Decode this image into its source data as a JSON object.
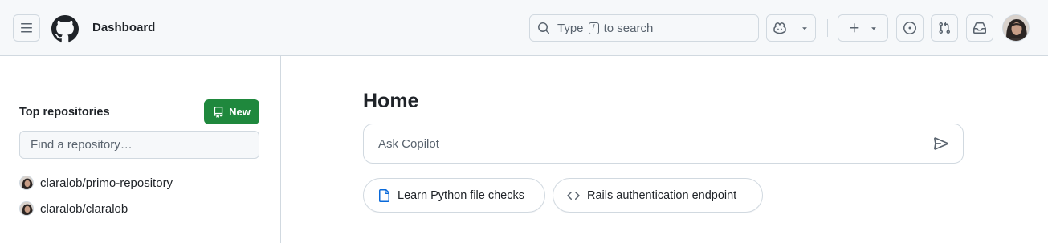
{
  "header": {
    "title": "Dashboard",
    "search": {
      "prefix": "Type",
      "key": "/",
      "suffix": "to search"
    },
    "icons": [
      "hamburger-menu-icon",
      "github-logo",
      "search-icon",
      "copilot-icon",
      "chevron-down-icon",
      "plus-icon",
      "issue-opened-icon",
      "git-pull-request-icon",
      "inbox-icon"
    ]
  },
  "sidebar": {
    "title": "Top repositories",
    "new_label": "New",
    "find_placeholder": "Find a repository…",
    "repos": [
      {
        "name": "claralob/primo-repository"
      },
      {
        "name": "claralob/claralob"
      }
    ]
  },
  "main": {
    "title": "Home",
    "ask_placeholder": "Ask Copilot",
    "suggestions": [
      {
        "label": "Learn Python file checks",
        "icon": "file-icon"
      },
      {
        "label": "Rails authentication endpoint",
        "icon": "code-icon"
      }
    ]
  },
  "colors": {
    "accent_green": "#1f883d",
    "header_bg": "#f6f8fa",
    "border": "#d1d9e0",
    "text": "#1f2328",
    "muted": "#59636e"
  }
}
